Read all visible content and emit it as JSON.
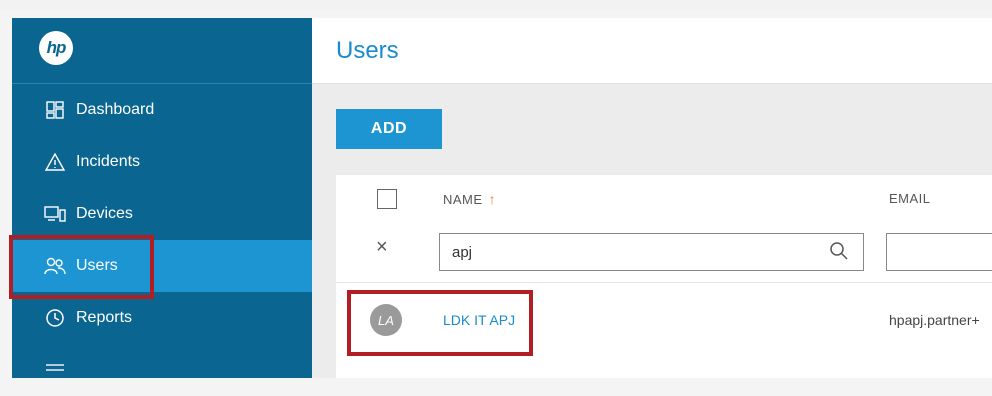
{
  "app": {
    "logo_text": "hp"
  },
  "sidebar": {
    "items": [
      {
        "label": "Dashboard",
        "icon": "dashboard-icon"
      },
      {
        "label": "Incidents",
        "icon": "warning-triangle-icon"
      },
      {
        "label": "Devices",
        "icon": "devices-icon"
      },
      {
        "label": "Users",
        "icon": "users-icon",
        "active": true
      },
      {
        "label": "Reports",
        "icon": "clock-report-icon"
      }
    ]
  },
  "main": {
    "title": "Users",
    "add_label": "ADD",
    "table": {
      "columns": [
        "NAME",
        "EMAIL"
      ],
      "sort_indicator": "↑",
      "clear_filter": "×",
      "filter": {
        "name_value": "apj",
        "email_value": ""
      },
      "rows": [
        {
          "initials": "LA",
          "name": "LDK IT APJ",
          "email": "hpapj.partner+"
        }
      ]
    }
  },
  "colors": {
    "sidebar_bg": "#0a6690",
    "active_bg": "#1d95d3",
    "accent": "#1a8ccb",
    "highlight_box": "#b11e23",
    "sort_arrow": "#e8891a"
  }
}
